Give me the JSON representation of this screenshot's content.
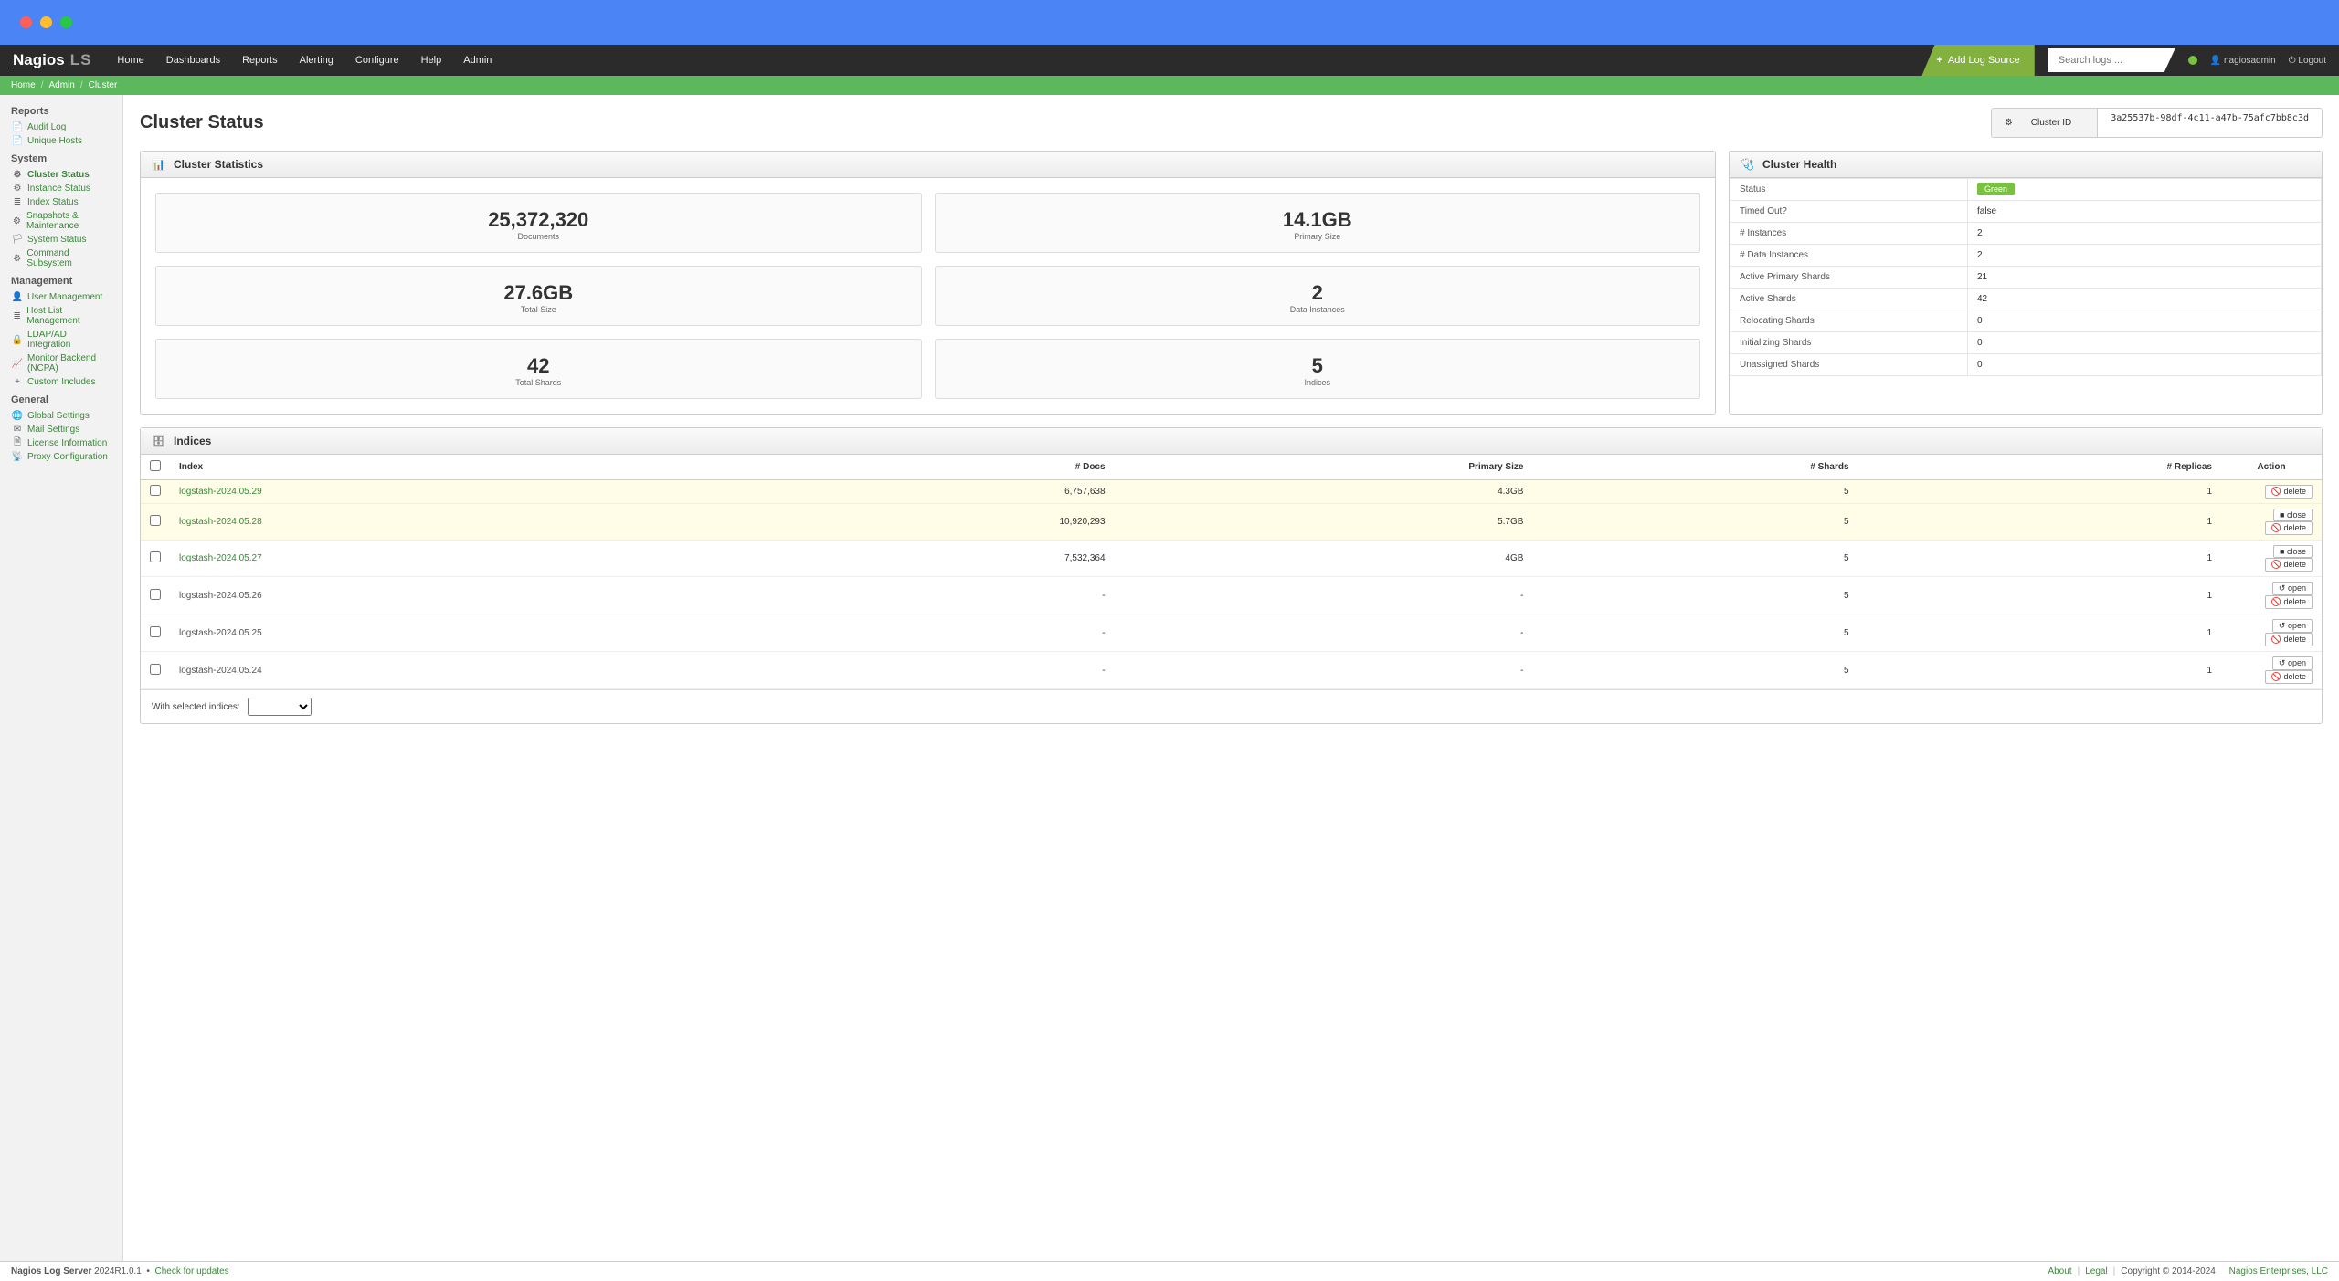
{
  "brand": {
    "nagios": "Nagios",
    "suffix": "LS",
    "registered": "®"
  },
  "nav": {
    "home": "Home",
    "dashboards": "Dashboards",
    "reports": "Reports",
    "alerting": "Alerting",
    "configure": "Configure",
    "help": "Help",
    "admin": "Admin"
  },
  "topright": {
    "add_log": "Add Log Source",
    "search_ph": "Search logs ...",
    "user": "nagiosadmin",
    "logout": "Logout"
  },
  "breadcrumb": {
    "home": "Home",
    "admin": "Admin",
    "cluster": "Cluster"
  },
  "sidebar": {
    "groups": [
      {
        "title": "Reports",
        "items": [
          {
            "name": "audit-log",
            "label": "Audit Log",
            "icon": "📄"
          },
          {
            "name": "unique-hosts",
            "label": "Unique Hosts",
            "icon": "📄"
          }
        ]
      },
      {
        "title": "System",
        "items": [
          {
            "name": "cluster-status",
            "label": "Cluster Status",
            "icon": "⚙",
            "active": true
          },
          {
            "name": "instance-status",
            "label": "Instance Status",
            "icon": "⚙"
          },
          {
            "name": "index-status",
            "label": "Index Status",
            "icon": "≣"
          },
          {
            "name": "snapshots",
            "label": "Snapshots & Maintenance",
            "icon": "⚙"
          },
          {
            "name": "system-status",
            "label": "System Status",
            "icon": "🏳"
          },
          {
            "name": "command-subsystem",
            "label": "Command Subsystem",
            "icon": "⚙"
          }
        ]
      },
      {
        "title": "Management",
        "items": [
          {
            "name": "user-management",
            "label": "User Management",
            "icon": "👤"
          },
          {
            "name": "host-list",
            "label": "Host List Management",
            "icon": "≣"
          },
          {
            "name": "ldap-ad",
            "label": "LDAP/AD Integration",
            "icon": "🔒"
          },
          {
            "name": "monitor-backend",
            "label": "Monitor Backend (NCPA)",
            "icon": "📈"
          },
          {
            "name": "custom-includes",
            "label": "Custom Includes",
            "icon": "+"
          }
        ]
      },
      {
        "title": "General",
        "items": [
          {
            "name": "global-settings",
            "label": "Global Settings",
            "icon": "🌐"
          },
          {
            "name": "mail-settings",
            "label": "Mail Settings",
            "icon": "✉"
          },
          {
            "name": "license-info",
            "label": "License Information",
            "icon": "🗎"
          },
          {
            "name": "proxy-config",
            "label": "Proxy Configuration",
            "icon": "📡"
          }
        ]
      }
    ]
  },
  "page": {
    "title": "Cluster Status",
    "cluster_id_label": "Cluster ID",
    "cluster_id": "3a25537b-98df-4c11-a47b-75afc7bb8c3d"
  },
  "stats_panel": {
    "title": "Cluster Statistics",
    "cards": [
      {
        "value": "25,372,320",
        "label": "Documents"
      },
      {
        "value": "14.1GB",
        "label": "Primary Size"
      },
      {
        "value": "27.6GB",
        "label": "Total Size"
      },
      {
        "value": "2",
        "label": "Data Instances"
      },
      {
        "value": "42",
        "label": "Total Shards"
      },
      {
        "value": "5",
        "label": "Indices"
      }
    ]
  },
  "health_panel": {
    "title": "Cluster Health",
    "rows": [
      {
        "k": "Status",
        "v": "Green",
        "badge": true
      },
      {
        "k": "Timed Out?",
        "v": "false"
      },
      {
        "k": "# Instances",
        "v": "2"
      },
      {
        "k": "# Data Instances",
        "v": "2"
      },
      {
        "k": "Active Primary Shards",
        "v": "21"
      },
      {
        "k": "Active Shards",
        "v": "42"
      },
      {
        "k": "Relocating Shards",
        "v": "0"
      },
      {
        "k": "Initializing Shards",
        "v": "0"
      },
      {
        "k": "Unassigned Shards",
        "v": "0"
      }
    ]
  },
  "indices_panel": {
    "title": "Indices",
    "headers": {
      "index": "Index",
      "docs": "# Docs",
      "primary": "Primary Size",
      "shards": "# Shards",
      "replicas": "# Replicas",
      "action": "Action"
    },
    "rows": [
      {
        "name": "logstash-2024.05.29",
        "docs": "6,757,638",
        "primary": "4.3GB",
        "shards": "5",
        "replicas": "1",
        "open": true,
        "link": true,
        "highlight": true,
        "actions": [
          "delete"
        ]
      },
      {
        "name": "logstash-2024.05.28",
        "docs": "10,920,293",
        "primary": "5.7GB",
        "shards": "5",
        "replicas": "1",
        "open": true,
        "link": true,
        "actions": [
          "close",
          "delete"
        ]
      },
      {
        "name": "logstash-2024.05.27",
        "docs": "7,532,364",
        "primary": "4GB",
        "shards": "5",
        "replicas": "1",
        "open": true,
        "link": true,
        "actions": [
          "close",
          "delete"
        ]
      },
      {
        "name": "logstash-2024.05.26",
        "docs": "-",
        "primary": "-",
        "shards": "5",
        "replicas": "1",
        "open": false,
        "actions": [
          "open",
          "delete"
        ]
      },
      {
        "name": "logstash-2024.05.25",
        "docs": "-",
        "primary": "-",
        "shards": "5",
        "replicas": "1",
        "open": false,
        "actions": [
          "open",
          "delete"
        ]
      },
      {
        "name": "logstash-2024.05.24",
        "docs": "-",
        "primary": "-",
        "shards": "5",
        "replicas": "1",
        "open": false,
        "actions": [
          "open",
          "delete"
        ]
      }
    ],
    "foot_label": "With selected indices:",
    "action_labels": {
      "delete": "delete",
      "close": "close",
      "open": "open"
    },
    "action_icons": {
      "delete": "🚫",
      "close": "■",
      "open": "↺"
    }
  },
  "footer": {
    "product": "Nagios Log Server",
    "version": "2024R1.0.1",
    "dot": "•",
    "check": "Check for updates",
    "about": "About",
    "legal": "Legal",
    "copyright": "Copyright © 2014-2024",
    "company": "Nagios Enterprises, LLC"
  }
}
